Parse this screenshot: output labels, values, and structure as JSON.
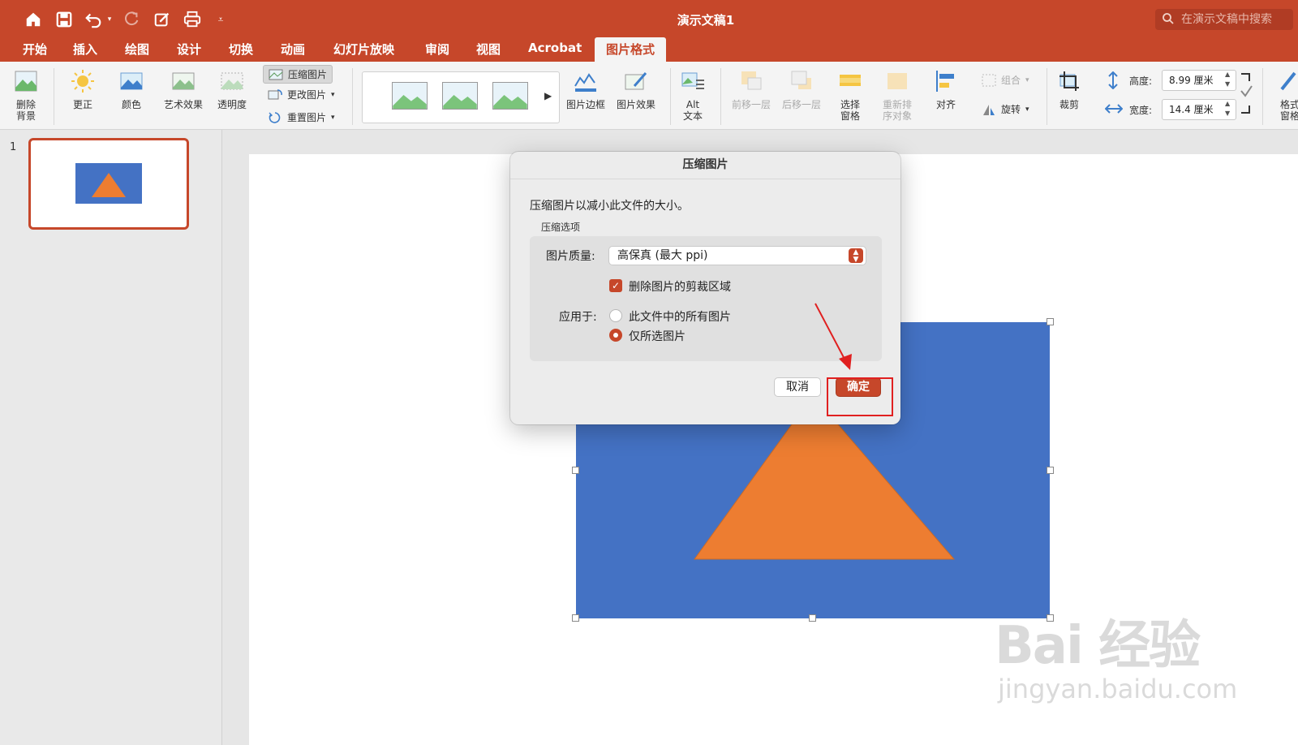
{
  "app": {
    "title": "演示文稿1",
    "search_placeholder": "在演示文稿中搜索"
  },
  "quick_access": [
    "home-icon",
    "save-icon",
    "undo-icon",
    "redo-icon",
    "edit-icon",
    "print-icon",
    "customize-icon"
  ],
  "tabs": [
    {
      "label": "开始"
    },
    {
      "label": "插入"
    },
    {
      "label": "绘图"
    },
    {
      "label": "设计"
    },
    {
      "label": "切换"
    },
    {
      "label": "动画"
    },
    {
      "label": "幻灯片放映"
    },
    {
      "label": "审阅"
    },
    {
      "label": "视图"
    },
    {
      "label": "Acrobat"
    },
    {
      "label": "图片格式",
      "active": true
    }
  ],
  "ribbon": {
    "remove_bg": "删除\n背景",
    "remove_bg_l1": "删除",
    "remove_bg_l2": "背景",
    "corrections": "更正",
    "color": "颜色",
    "artistic": "艺术效果",
    "transparency": "透明度",
    "compress": "压缩图片",
    "change_pic": "更改图片",
    "reset_pic": "重置图片",
    "pic_border": "图片边框",
    "pic_effects": "图片效果",
    "alt_text_l1": "Alt",
    "alt_text_l2": "文本",
    "bring_forward": "前移一层",
    "send_backward": "后移一层",
    "selection_pane_l1": "选择",
    "selection_pane_l2": "窗格",
    "reorder_l1": "重新排",
    "reorder_l2": "序对象",
    "align": "对齐",
    "group": "组合",
    "rotate": "旋转",
    "crop": "裁剪",
    "height_label": "高度:",
    "height_value": "8.99 厘米",
    "width_label": "宽度:",
    "width_value": "14.4 厘米",
    "format_pane_l1": "格式",
    "format_pane_l2": "窗格"
  },
  "slides_pane": {
    "slide_number": "1"
  },
  "dialog": {
    "title": "压缩图片",
    "description": "压缩图片以减小此文件的大小。",
    "group_label": "压缩选项",
    "quality_label": "图片质量:",
    "quality_value": "高保真 (最大 ppi)",
    "delete_crop_label": "删除图片的剪裁区域",
    "delete_crop_checked": true,
    "apply_to_label": "应用于:",
    "apply_all_label": "此文件中的所有图片",
    "apply_selected_label": "仅所选图片",
    "apply_selected": true,
    "cancel_label": "取消",
    "ok_label": "确定"
  },
  "watermark": {
    "brand": "Bai 经验",
    "url": "jingyan.baidu.com"
  },
  "colors": {
    "accent": "#c6472a",
    "picture_bg": "#4472c4",
    "triangle": "#ed7d31"
  }
}
